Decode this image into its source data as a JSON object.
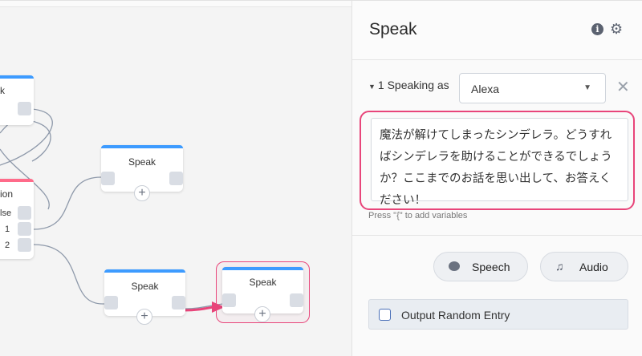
{
  "canvas": {
    "node_partial_top": {
      "title_fragment": "ak"
    },
    "node_condition": {
      "title_fragment": "ion",
      "paths": [
        "lse",
        "1",
        "2"
      ]
    },
    "node_speak_a": {
      "title": "Speak"
    },
    "node_speak_b": {
      "title": "Speak"
    },
    "node_speak_selected": {
      "title": "Speak"
    },
    "add_symbol": "+"
  },
  "panel": {
    "title": "Speak",
    "info_icon": "info-icon",
    "settings_icon": "gear-icon",
    "speaking_label": "1 Speaking as",
    "voice_select": {
      "value": "Alexa"
    },
    "remove_icon": "close-icon",
    "speech_text": "魔法が解けてしまったシンデレラ。どうすればシンデレラを助けることができるでしょうか？ここまでのお話を思い出して、お答えください！",
    "variables_hint": "Press \"{\" to add variables",
    "buttons": {
      "speech": "Speech",
      "audio": "Audio"
    },
    "random_entry": {
      "label": "Output Random Entry",
      "checked": false
    }
  },
  "colors": {
    "accent_blue": "#3d9bff",
    "highlight_pink": "#e8457a",
    "condition_pink": "#ff6b8a"
  }
}
